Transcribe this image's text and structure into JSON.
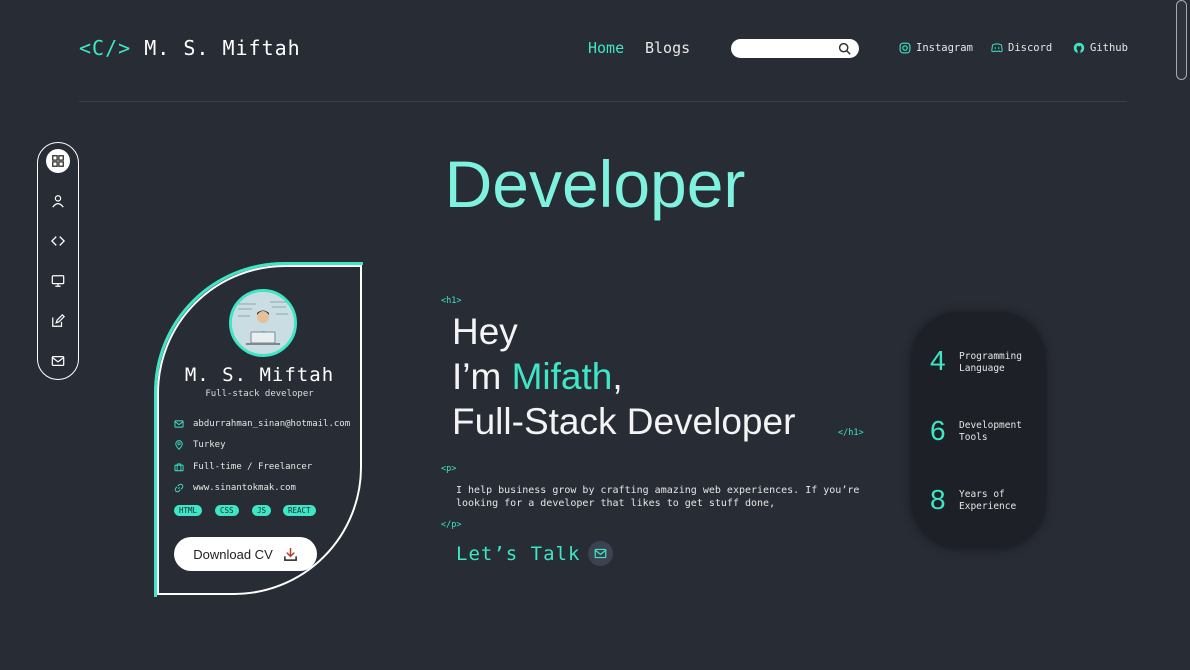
{
  "header": {
    "logo_bracket": "<C/>",
    "logo_name": "M. S. Miftah",
    "nav": [
      "Home",
      "Blogs"
    ],
    "search_placeholder": "",
    "social": [
      "Instagram",
      "Discord",
      "Github"
    ]
  },
  "hero": {
    "title": "Developer",
    "tag_h1_open": "<h1>",
    "tag_h1_close": "</h1>",
    "tag_p_open": "<p>",
    "tag_p_close": "</p>",
    "line1": "Hey",
    "line2_prefix": "I’m ",
    "line2_name": "Mifath",
    "line2_suffix": ",",
    "line3": "Full-Stack Developer",
    "paragraph": "I help business grow by crafting amazing web experiences. If you’re looking for a developer that likes to get stuff done,",
    "cta": "Let’s Talk"
  },
  "card": {
    "name": "M. S. Miftah",
    "role": "Full-stack developer",
    "email": "abdurrahman_sinan@hotmail.com",
    "location": "Turkey",
    "availability": "Full-time / Freelancer",
    "website": "www.sinantokmak.com",
    "tags": [
      "HTML",
      "CSS",
      "JS",
      "REACT"
    ],
    "cv_button": "Download CV"
  },
  "stats": [
    {
      "num": "4",
      "label_1": "Programming",
      "label_2": "Language"
    },
    {
      "num": "6",
      "label_1": "Development",
      "label_2": "Tools"
    },
    {
      "num": "8",
      "label_1": "Years of",
      "label_2": "Experience"
    }
  ],
  "colors": {
    "accent": "#3ee6c6",
    "title": "#7ef2de",
    "background": "#282c35"
  }
}
